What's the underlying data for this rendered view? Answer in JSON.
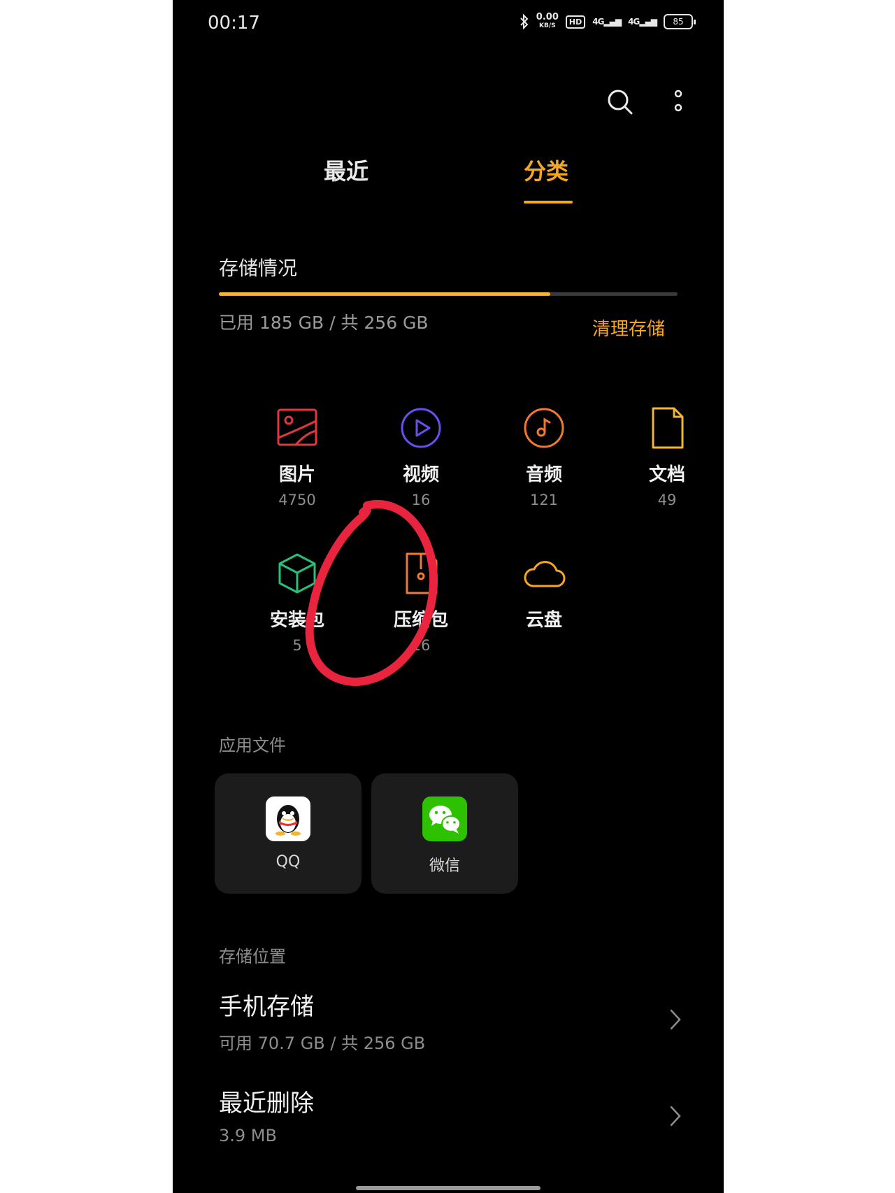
{
  "status_bar": {
    "time": "00:17",
    "speed_value": "0.00",
    "speed_unit": "KB/S",
    "hd": "HD",
    "sim1": "4G",
    "sim2": "4G",
    "battery": "85"
  },
  "header": {
    "search_icon": "search-icon",
    "more_icon": "more-vertical-icon"
  },
  "tabs": [
    {
      "label": "最近",
      "active": false
    },
    {
      "label": "分类",
      "active": true
    }
  ],
  "storage": {
    "title": "存储情况",
    "used_text": "已用 185 GB / 共 256 GB",
    "used_fraction": 0.7227,
    "clean_label": "清理存储"
  },
  "categories": [
    {
      "label": "图片",
      "count": "4750",
      "icon": "image-icon",
      "color": "#e0373f"
    },
    {
      "label": "视频",
      "count": "16",
      "icon": "video-icon",
      "color": "#6a4ff0"
    },
    {
      "label": "音频",
      "count": "121",
      "icon": "audio-icon",
      "color": "#f07a30"
    },
    {
      "label": "文档",
      "count": "49",
      "icon": "document-icon",
      "color": "#f5b531"
    },
    {
      "label": "安装包",
      "count": "5",
      "icon": "package-icon",
      "color": "#27c07a"
    },
    {
      "label": "压缩包",
      "count": "16",
      "icon": "archive-icon",
      "color": "#f07a30"
    },
    {
      "label": "云盘",
      "count": "",
      "icon": "cloud-icon",
      "color": "#f5a623"
    }
  ],
  "annotation_color": "#e8243f",
  "app_files": {
    "title": "应用文件",
    "apps": [
      {
        "label": "QQ",
        "icon": "qq-icon"
      },
      {
        "label": "微信",
        "icon": "wechat-icon"
      }
    ]
  },
  "storage_location": {
    "title": "存储位置",
    "items": [
      {
        "title": "手机存储",
        "sub": "可用 70.7 GB / 共 256 GB"
      },
      {
        "title": "最近删除",
        "sub": "3.9 MB"
      }
    ]
  }
}
